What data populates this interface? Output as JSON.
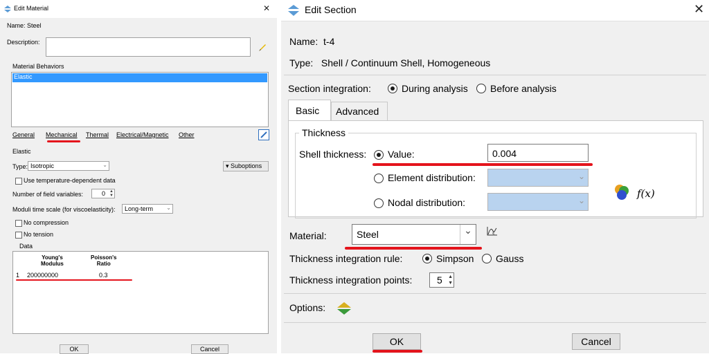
{
  "colors": {
    "accent": "#0078d7",
    "selection": "#3399ff",
    "annotation": "#e4141c",
    "disabled_field": "#b9d3ef"
  },
  "material_dialog": {
    "title": "Edit Material",
    "name_label": "Name:",
    "name_value": "Steel",
    "description_label": "Description:",
    "behaviors_label": "Material Behaviors",
    "behaviors": [
      "Elastic"
    ],
    "menus": [
      "General",
      "Mechanical",
      "Thermal",
      "Electrical/Magnetic",
      "Other"
    ],
    "section_title": "Elastic",
    "type_label": "Type:",
    "type_value": "Isotropic",
    "suboptions_label": "Suboptions",
    "temp_dependent_label": "Use temperature-dependent data",
    "field_vars_label": "Number of field variables:",
    "field_vars_value": "0",
    "moduli_label": "Moduli time scale (for viscoelasticity):",
    "moduli_value": "Long-term",
    "no_compression_label": "No compression",
    "no_tension_label": "No tension",
    "data_label": "Data",
    "table": {
      "headers": [
        [
          "Young's",
          "Modulus"
        ],
        [
          "Poisson's",
          "Ratio"
        ]
      ],
      "rows": [
        {
          "index": "1",
          "modulus": "200000000",
          "ratio": "0.3"
        }
      ]
    },
    "ok_label": "OK",
    "cancel_label": "Cancel"
  },
  "section_dialog": {
    "title": "Edit Section",
    "name_label": "Name:",
    "name_value": "t-4",
    "type_label": "Type:",
    "type_value": "Shell / Continuum Shell, Homogeneous",
    "integration_label": "Section integration:",
    "integration_options": [
      "During analysis",
      "Before analysis"
    ],
    "tabs": [
      "Basic",
      "Advanced"
    ],
    "thickness_group": "Thickness",
    "shell_thickness_label": "Shell thickness:",
    "value_label": "Value:",
    "value": "0.004",
    "element_dist_label": "Element distribution:",
    "nodal_dist_label": "Nodal distribution:",
    "fx_label": "f(x)",
    "material_label": "Material:",
    "material_value": "Steel",
    "rule_label": "Thickness integration rule:",
    "rule_options": [
      "Simpson",
      "Gauss"
    ],
    "points_label": "Thickness integration points:",
    "points_value": "5",
    "options_label": "Options:",
    "ok_label": "OK",
    "cancel_label": "Cancel"
  }
}
